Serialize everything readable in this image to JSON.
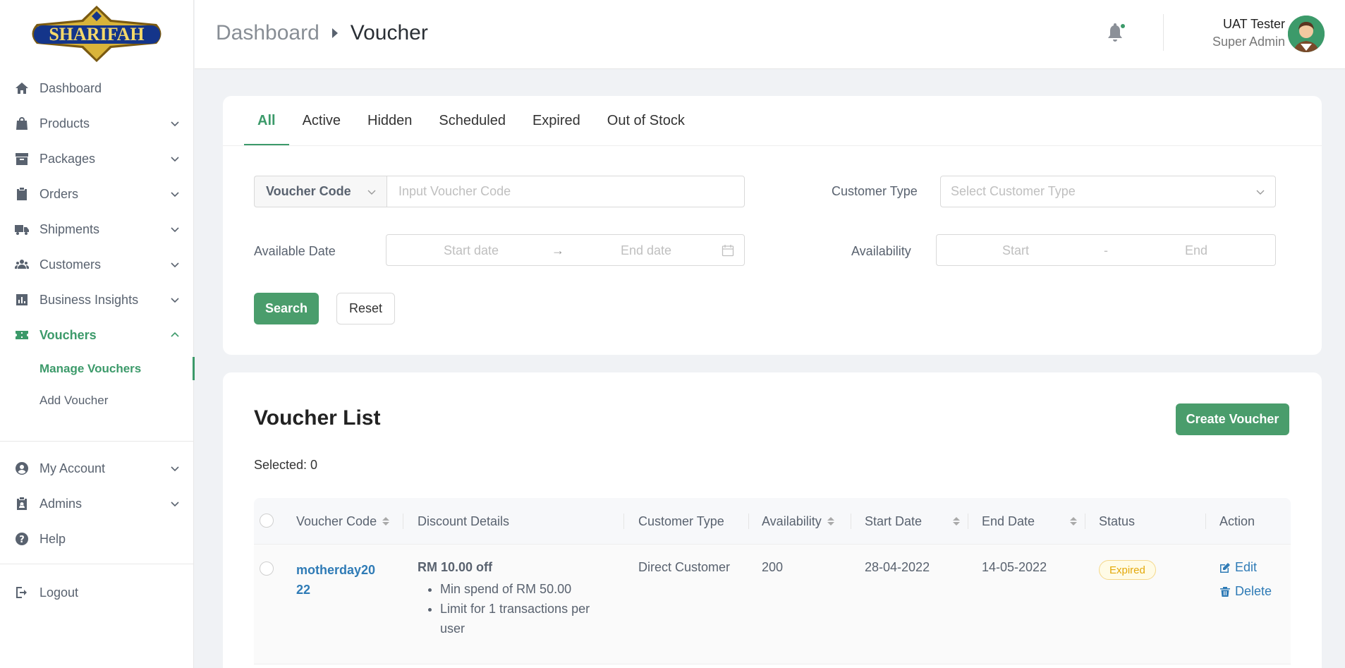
{
  "brand": {
    "logo_text": "SHARIFAH",
    "accent": "#3c9a6a"
  },
  "sidebar": {
    "items": [
      {
        "label": "Dashboard",
        "icon": "home-icon"
      },
      {
        "label": "Products",
        "icon": "bag-icon"
      },
      {
        "label": "Packages",
        "icon": "box-icon"
      },
      {
        "label": "Orders",
        "icon": "clipboard-icon"
      },
      {
        "label": "Shipments",
        "icon": "truck-icon"
      },
      {
        "label": "Customers",
        "icon": "users-icon"
      },
      {
        "label": "Business Insights",
        "icon": "chart-icon"
      },
      {
        "label": "Vouchers",
        "icon": "ticket-icon"
      }
    ],
    "sub_items": [
      {
        "label": "Manage Vouchers"
      },
      {
        "label": "Add Voucher"
      }
    ],
    "bottom_items": [
      {
        "label": "My Account",
        "icon": "user-circle-icon"
      },
      {
        "label": "Admins",
        "icon": "admin-icon"
      },
      {
        "label": "Help",
        "icon": "help-icon"
      }
    ],
    "logout": "Logout"
  },
  "header": {
    "breadcrumb": [
      "Dashboard",
      "Voucher"
    ],
    "user_name": "UAT Tester",
    "user_role": "Super Admin"
  },
  "filters": {
    "tabs": [
      "All",
      "Active",
      "Hidden",
      "Scheduled",
      "Expired",
      "Out of Stock"
    ],
    "active_tab": "All",
    "code_select": "Voucher Code",
    "code_placeholder": "Input Voucher Code",
    "customer_type_label": "Customer Type",
    "customer_type_placeholder": "Select Customer Type",
    "available_date_label": "Available Date",
    "start_date_placeholder": "Start date",
    "end_date_placeholder": "End date",
    "availability_label": "Availability",
    "availability_start": "Start",
    "availability_sep": "-",
    "availability_end": "End",
    "search_label": "Search",
    "reset_label": "Reset"
  },
  "list": {
    "title": "Voucher List",
    "create_label": "Create Voucher",
    "selected_text": "Selected: 0",
    "columns": [
      "Voucher Code",
      "Discount Details",
      "Customer Type",
      "Availability",
      "Start Date",
      "End Date",
      "Status",
      "Action"
    ],
    "rows": [
      {
        "code_line1": "motherday20",
        "code_line2": "22",
        "discount_title": "RM 10.00 off",
        "discount_details": [
          "Min spend of RM 50.00",
          "Limit for 1 transactions per user"
        ],
        "customer_type": "Direct Customer",
        "availability": "200",
        "start_date": "28-04-2022",
        "end_date": "14-05-2022",
        "status": "Expired",
        "edit_label": "Edit",
        "delete_label": "Delete"
      }
    ]
  }
}
